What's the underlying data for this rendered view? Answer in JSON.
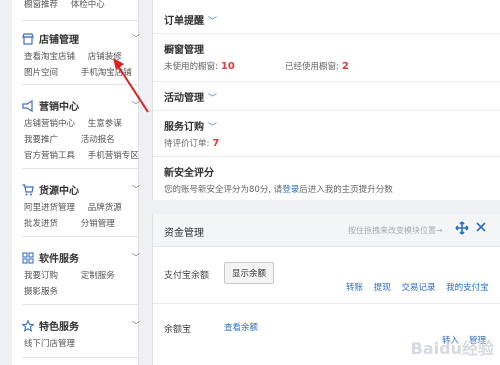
{
  "sidebar": {
    "top_items": [
      "橱窗推荐",
      "体检中心"
    ],
    "sections": [
      {
        "title": "店铺管理",
        "icon": "store-icon",
        "rows": [
          [
            "查看淘宝店铺",
            "店铺装修"
          ],
          [
            "图片空间",
            "手机淘宝店铺"
          ]
        ]
      },
      {
        "title": "营销中心",
        "icon": "megaphone-icon",
        "rows": [
          [
            "店铺营销中心",
            "生意参谋"
          ],
          [
            "我要推广",
            "活动报名"
          ],
          [
            "官方营销工具",
            "手机营销专区"
          ]
        ]
      },
      {
        "title": "货源中心",
        "icon": "cart-icon",
        "rows": [
          [
            "阿里进货管理",
            "品牌货源"
          ],
          [
            "批发进货",
            "分销管理"
          ]
        ]
      },
      {
        "title": "软件服务",
        "icon": "grid-icon",
        "rows": [
          [
            "我要订购",
            "定制服务"
          ],
          [
            "摄影服务",
            ""
          ]
        ]
      },
      {
        "title": "特色服务",
        "icon": "star-icon",
        "rows": [
          [
            "线下门店管理",
            ""
          ]
        ]
      }
    ]
  },
  "main": {
    "order_reminder": "订单提醒",
    "showcase": {
      "title": "橱窗管理",
      "unused_label": "未使用的橱窗:",
      "unused_value": "10",
      "used_label": "已经使用橱窗:",
      "used_value": "2"
    },
    "activity": "活动管理",
    "service_order": {
      "title": "服务订购",
      "pending_label": "待评价订单:",
      "pending_value": "7"
    },
    "security": {
      "title": "新安全评分",
      "text_before": "您的账号新安全评分为80分, 请",
      "link": "登录",
      "text_after": "后进入我的主页提升分数"
    }
  },
  "funds": {
    "title": "资金管理",
    "hint": "按住拖拽来改变模块位置→",
    "alipay_label": "支付宝余额",
    "show_balance_button": "显示余额",
    "links": [
      "转账",
      "提现",
      "交易记录",
      "我的支付宝"
    ],
    "yuebao_label": "余额宝",
    "yuebao_link": "查看余额",
    "transfer_in": "转入",
    "manage": "管理"
  },
  "watermark": "Baidu经验",
  "colors": {
    "accent": "#2b6fc9",
    "number": "#e4393c",
    "arrow": "#e02020"
  }
}
